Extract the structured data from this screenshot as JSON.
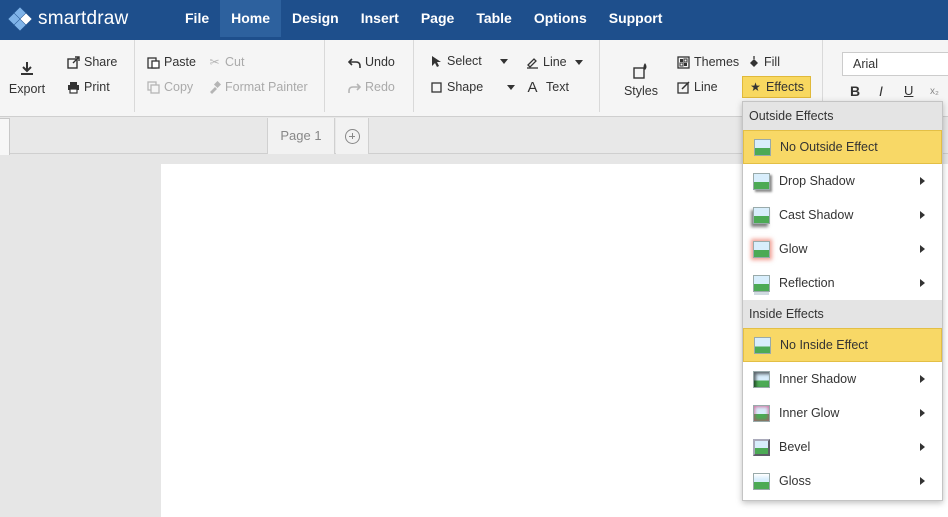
{
  "app": {
    "logo_text": "smartdraw"
  },
  "menu": {
    "items": [
      {
        "label": "File"
      },
      {
        "label": "Home"
      },
      {
        "label": "Design"
      },
      {
        "label": "Insert"
      },
      {
        "label": "Page"
      },
      {
        "label": "Table"
      },
      {
        "label": "Options"
      },
      {
        "label": "Support"
      }
    ],
    "active": "Home"
  },
  "ribbon": {
    "export": "Export",
    "share": "Share",
    "print": "Print",
    "paste": "Paste",
    "cut": "Cut",
    "copy": "Copy",
    "format_painter": "Format Painter",
    "undo": "Undo",
    "redo": "Redo",
    "select": "Select",
    "shape": "Shape",
    "line_tool": "Line",
    "text": "Text",
    "styles": "Styles",
    "themes": "Themes",
    "line_style": "Line",
    "fill": "Fill",
    "effects": "Effects",
    "font": "Arial",
    "bold": "B",
    "italic": "I",
    "underline": "U",
    "subscript": "x₂"
  },
  "tabs": {
    "page_tab": "Page 1"
  },
  "dropdown": {
    "outside_header": "Outside Effects",
    "outside_items": [
      {
        "label": "No Outside Effect",
        "selected": true,
        "has_submenu": false
      },
      {
        "label": "Drop Shadow",
        "selected": false,
        "has_submenu": true
      },
      {
        "label": "Cast Shadow",
        "selected": false,
        "has_submenu": true
      },
      {
        "label": "Glow",
        "selected": false,
        "has_submenu": true
      },
      {
        "label": "Reflection",
        "selected": false,
        "has_submenu": true
      }
    ],
    "inside_header": "Inside Effects",
    "inside_items": [
      {
        "label": "No Inside Effect",
        "selected": true,
        "has_submenu": false
      },
      {
        "label": "Inner Shadow",
        "selected": false,
        "has_submenu": true
      },
      {
        "label": "Inner Glow",
        "selected": false,
        "has_submenu": true
      },
      {
        "label": "Bevel",
        "selected": false,
        "has_submenu": true
      },
      {
        "label": "Gloss",
        "selected": false,
        "has_submenu": true
      }
    ]
  },
  "colors": {
    "topbar": "#1e4f8c",
    "active_menu": "#2d619e",
    "highlight": "#f8d866"
  }
}
